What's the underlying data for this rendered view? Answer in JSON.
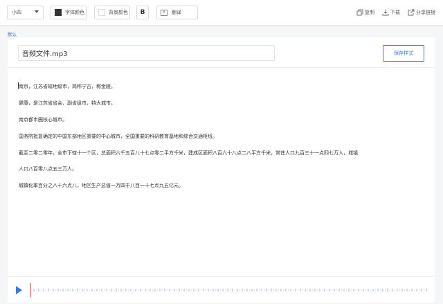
{
  "toolbar": {
    "font_size": "小四",
    "font_color_label": "字体颜色",
    "font_color_value": "#333333",
    "bg_color_label": "背景颜色",
    "bold_label": "B",
    "translate_label": "翻译",
    "translate_icon_glyph": "A",
    "copy_label": "复制",
    "download_label": "下载",
    "share_label": "分享链接"
  },
  "tag": "默认",
  "editor": {
    "title": "音频文件.mp3",
    "save_style_label": "保存样式",
    "paragraphs": [
      "南京，江苏省辖地级市，简称宁古，称金陵。",
      "健康，是江苏省省会、副省级市、特大城市。",
      "南京都市圈核心城市。",
      "国务院批复确定的中国东部地区重要的中心城市，全国重要的科研教育基地和综合交通枢纽。",
      "截至二零二零年，全市下辖十一个区，总面积六千五百八十七点零二平方千米，建成区面积八百六十八点二八平方千米，常住人口九百三十一点四七万人，城镇",
      "人口八百零八点五三万人。",
      "城镇化率百分之八十六点八，地区生产总值一万四千八百一十七点九五亿元。"
    ]
  },
  "colors": {
    "accent": "#3a7bd5",
    "playhead": "#e05050"
  },
  "icons": [
    "chevron-down-icon",
    "translate-icon",
    "copy-icon",
    "download-icon",
    "share-icon",
    "play-icon"
  ]
}
